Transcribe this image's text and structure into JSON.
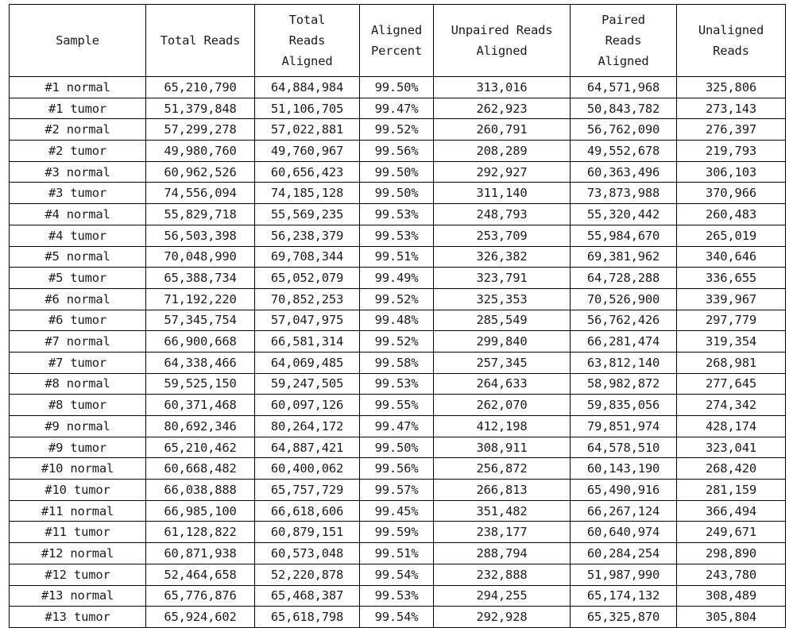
{
  "table": {
    "columns": [
      {
        "key": "sample",
        "label": "Sample"
      },
      {
        "key": "total_reads",
        "label": "Total Reads"
      },
      {
        "key": "total_aligned",
        "label": "Total\nReads\nAligned"
      },
      {
        "key": "aligned_percent",
        "label": "Aligned\nPercent"
      },
      {
        "key": "unpaired",
        "label": "Unpaired Reads\nAligned"
      },
      {
        "key": "paired",
        "label": "Paired\nReads\nAligned"
      },
      {
        "key": "unaligned",
        "label": "Unaligned\nReads"
      }
    ],
    "rows": [
      [
        "#1 normal",
        "65,210,790",
        "64,884,984",
        "99.50%",
        "313,016",
        "64,571,968",
        "325,806"
      ],
      [
        "#1 tumor",
        "51,379,848",
        "51,106,705",
        "99.47%",
        "262,923",
        "50,843,782",
        "273,143"
      ],
      [
        "#2 normal",
        "57,299,278",
        "57,022,881",
        "99.52%",
        "260,791",
        "56,762,090",
        "276,397"
      ],
      [
        "#2 tumor",
        "49,980,760",
        "49,760,967",
        "99.56%",
        "208,289",
        "49,552,678",
        "219,793"
      ],
      [
        "#3 normal",
        "60,962,526",
        "60,656,423",
        "99.50%",
        "292,927",
        "60,363,496",
        "306,103"
      ],
      [
        "#3 tumor",
        "74,556,094",
        "74,185,128",
        "99.50%",
        "311,140",
        "73,873,988",
        "370,966"
      ],
      [
        "#4 normal",
        "55,829,718",
        "55,569,235",
        "99.53%",
        "248,793",
        "55,320,442",
        "260,483"
      ],
      [
        "#4 tumor",
        "56,503,398",
        "56,238,379",
        "99.53%",
        "253,709",
        "55,984,670",
        "265,019"
      ],
      [
        "#5 normal",
        "70,048,990",
        "69,708,344",
        "99.51%",
        "326,382",
        "69,381,962",
        "340,646"
      ],
      [
        "#5 tumor",
        "65,388,734",
        "65,052,079",
        "99.49%",
        "323,791",
        "64,728,288",
        "336,655"
      ],
      [
        "#6 normal",
        "71,192,220",
        "70,852,253",
        "99.52%",
        "325,353",
        "70,526,900",
        "339,967"
      ],
      [
        "#6 tumor",
        "57,345,754",
        "57,047,975",
        "99.48%",
        "285,549",
        "56,762,426",
        "297,779"
      ],
      [
        "#7 normal",
        "66,900,668",
        "66,581,314",
        "99.52%",
        "299,840",
        "66,281,474",
        "319,354"
      ],
      [
        "#7 tumor",
        "64,338,466",
        "64,069,485",
        "99.58%",
        "257,345",
        "63,812,140",
        "268,981"
      ],
      [
        "#8 normal",
        "59,525,150",
        "59,247,505",
        "99.53%",
        "264,633",
        "58,982,872",
        "277,645"
      ],
      [
        "#8 tumor",
        "60,371,468",
        "60,097,126",
        "99.55%",
        "262,070",
        "59,835,056",
        "274,342"
      ],
      [
        "#9 normal",
        "80,692,346",
        "80,264,172",
        "99.47%",
        "412,198",
        "79,851,974",
        "428,174"
      ],
      [
        "#9 tumor",
        "65,210,462",
        "64,887,421",
        "99.50%",
        "308,911",
        "64,578,510",
        "323,041"
      ],
      [
        "#10 normal",
        "60,668,482",
        "60,400,062",
        "99.56%",
        "256,872",
        "60,143,190",
        "268,420"
      ],
      [
        "#10 tumor",
        "66,038,888",
        "65,757,729",
        "99.57%",
        "266,813",
        "65,490,916",
        "281,159"
      ],
      [
        "#11 normal",
        "66,985,100",
        "66,618,606",
        "99.45%",
        "351,482",
        "66,267,124",
        "366,494"
      ],
      [
        "#11 tumor",
        "61,128,822",
        "60,879,151",
        "99.59%",
        "238,177",
        "60,640,974",
        "249,671"
      ],
      [
        "#12 normal",
        "60,871,938",
        "60,573,048",
        "99.51%",
        "288,794",
        "60,284,254",
        "298,890"
      ],
      [
        "#12 tumor",
        "52,464,658",
        "52,220,878",
        "99.54%",
        "232,888",
        "51,987,990",
        "243,780"
      ],
      [
        "#13 normal",
        "65,776,876",
        "65,468,387",
        "99.53%",
        "294,255",
        "65,174,132",
        "308,489"
      ],
      [
        "#13 tumor",
        "65,924,602",
        "65,618,798",
        "99.54%",
        "292,928",
        "65,325,870",
        "305,804"
      ]
    ]
  },
  "style": {
    "border_color": "#000000",
    "text_color": "#1b1b1b",
    "background": "#ffffff"
  }
}
